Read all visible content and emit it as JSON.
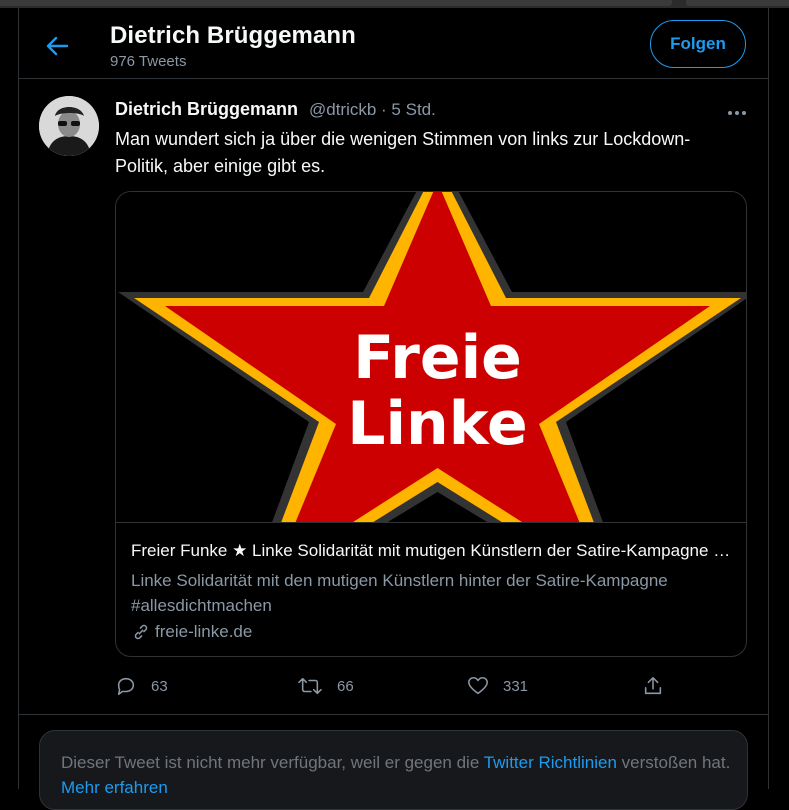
{
  "header": {
    "title": "Dietrich Brüggemann",
    "tweet_count": "976 Tweets",
    "follow_label": "Folgen"
  },
  "tweet": {
    "display_name": "Dietrich Brüggemann",
    "meta": "@dtrickb · 5 Std.",
    "text": "Man wundert sich ja über die wenigen Stimmen von links zur Lockdown-Politik, aber einige gibt es.",
    "card": {
      "image_text_line1": "Freie",
      "image_text_line2": "Linke",
      "title": "Freier Funke ★ Linke Solidarität mit mutigen Künstlern der Satire-Kampagne #allesdichtmachen",
      "description": "Linke Solidarität mit den mutigen Künstlern hinter der Satire-Kampagne #allesdichtmachen",
      "domain": "freie-linke.de"
    },
    "actions": {
      "replies": "63",
      "retweets": "66",
      "likes": "331"
    }
  },
  "notice": {
    "text_before": "Dieser Tweet ist nicht mehr verfügbar, weil er gegen die ",
    "policy_link": "Twitter Richtlinien",
    "text_after": " verstoßen hat. ",
    "more_link": "Mehr erfahren"
  },
  "colors": {
    "accent": "#1d9bf0",
    "star_red": "#cc0000",
    "star_outline": "#ffb400"
  }
}
